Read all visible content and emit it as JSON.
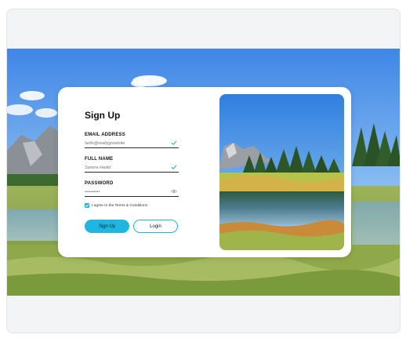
{
  "form": {
    "title": "Sign Up",
    "email": {
      "label": "EMAIL ADDRESS",
      "placeholder": "hello@reallygreatsite"
    },
    "full_name": {
      "label": "FULL NAME",
      "placeholder": "Samira Hadid"
    },
    "password": {
      "label": "PASSWORD",
      "placeholder": "••••••••••"
    },
    "terms": {
      "label": "I agree to the Terms & Conditions",
      "checked": true
    },
    "signup_label": "Sign Up",
    "login_label": "Login"
  },
  "colors": {
    "accent": "#1fb6e0",
    "card": "#ffffff",
    "frame": "#f3f4f6"
  },
  "icons": {
    "email_status": "check-icon",
    "name_status": "check-icon",
    "password_toggle": "eye-icon"
  }
}
